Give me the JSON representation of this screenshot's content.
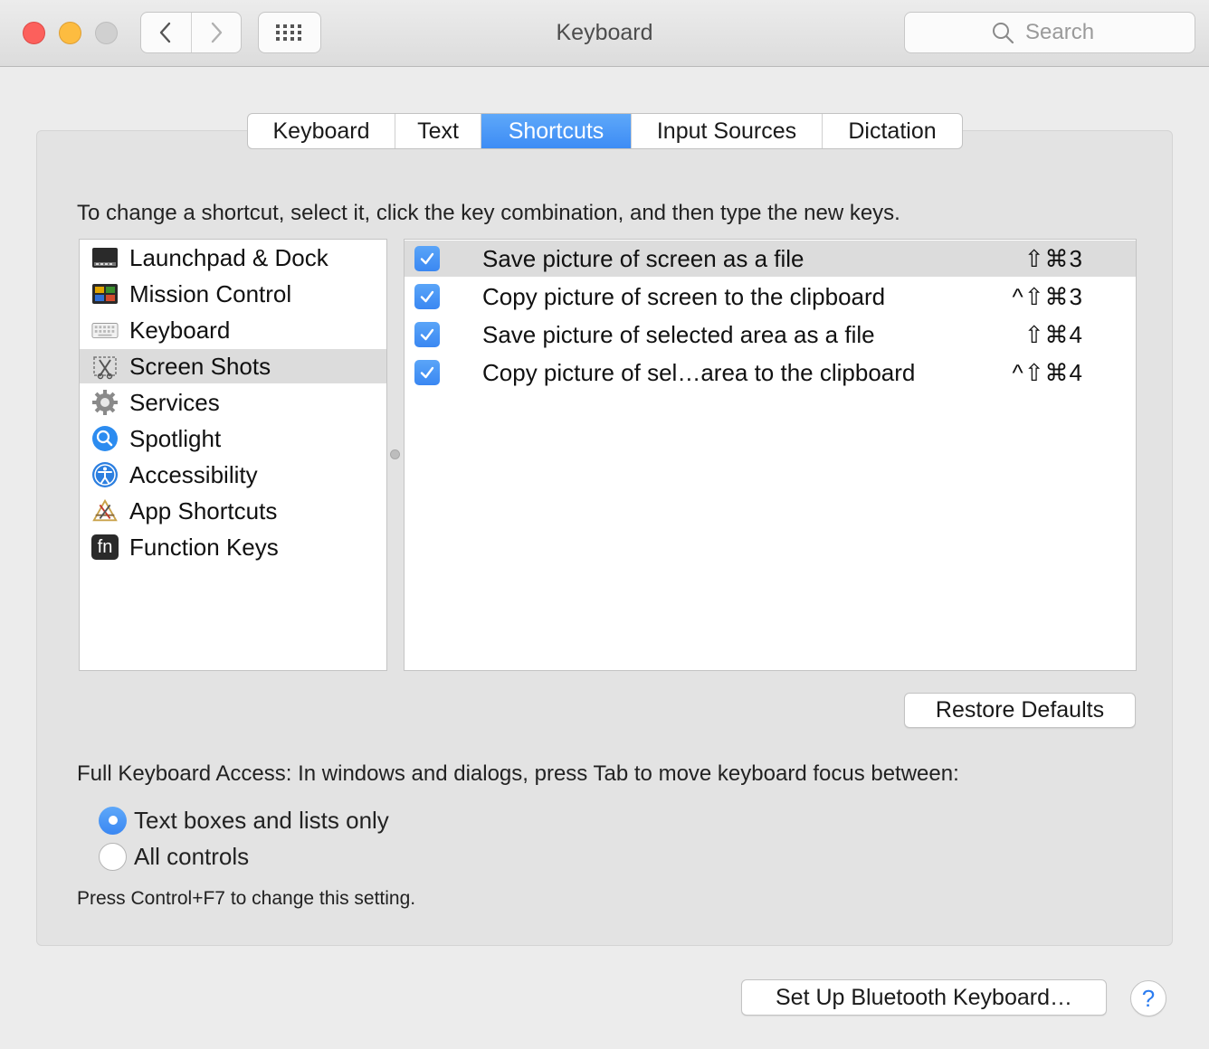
{
  "window": {
    "title": "Keyboard"
  },
  "toolbar": {
    "back_icon": "chevron-left-icon",
    "forward_icon": "chevron-right-icon",
    "show_all_icon": "grid-icon",
    "search_placeholder": "Search"
  },
  "tabs": [
    {
      "label": "Keyboard",
      "active": false
    },
    {
      "label": "Text",
      "active": false
    },
    {
      "label": "Shortcuts",
      "active": true
    },
    {
      "label": "Input Sources",
      "active": false
    },
    {
      "label": "Dictation",
      "active": false
    }
  ],
  "instruction": "To change a shortcut, select it, click the key combination, and then type the new keys.",
  "categories": [
    {
      "label": "Launchpad & Dock",
      "icon": "launchpad-dock-icon",
      "selected": false
    },
    {
      "label": "Mission Control",
      "icon": "mission-control-icon",
      "selected": false
    },
    {
      "label": "Keyboard",
      "icon": "keyboard-icon",
      "selected": false
    },
    {
      "label": "Screen Shots",
      "icon": "screenshot-icon",
      "selected": true
    },
    {
      "label": "Services",
      "icon": "gear-icon",
      "selected": false
    },
    {
      "label": "Spotlight",
      "icon": "spotlight-icon",
      "selected": false
    },
    {
      "label": "Accessibility",
      "icon": "accessibility-icon",
      "selected": false
    },
    {
      "label": "App Shortcuts",
      "icon": "app-shortcuts-icon",
      "selected": false
    },
    {
      "label": "Function Keys",
      "icon": "fn-key-icon",
      "selected": false,
      "icon_text": "fn"
    }
  ],
  "shortcuts": [
    {
      "checked": true,
      "label": "Save picture of screen as a file",
      "keys": "⇧⌘3",
      "selected": true
    },
    {
      "checked": true,
      "label": "Copy picture of screen to the clipboard",
      "keys": "^⇧⌘3",
      "selected": false
    },
    {
      "checked": true,
      "label": "Save picture of selected area as a file",
      "keys": "⇧⌘4",
      "selected": false
    },
    {
      "checked": true,
      "label": "Copy picture of sel…area to the clipboard",
      "keys": "^⇧⌘4",
      "selected": false
    }
  ],
  "restore_defaults": "Restore Defaults",
  "full_keyboard_access": {
    "label": "Full Keyboard Access: In windows and dialogs, press Tab to move keyboard focus between:",
    "options": [
      {
        "label": "Text boxes and lists only",
        "selected": true
      },
      {
        "label": "All controls",
        "selected": false
      }
    ],
    "hint": "Press Control+F7 to change this setting."
  },
  "bluetooth_button": "Set Up Bluetooth Keyboard…",
  "help_button": "?",
  "colors": {
    "accent": "#3d8cf5",
    "selection": "#dcdcdc",
    "close": "#fc605c",
    "minimize": "#fdbc40"
  }
}
